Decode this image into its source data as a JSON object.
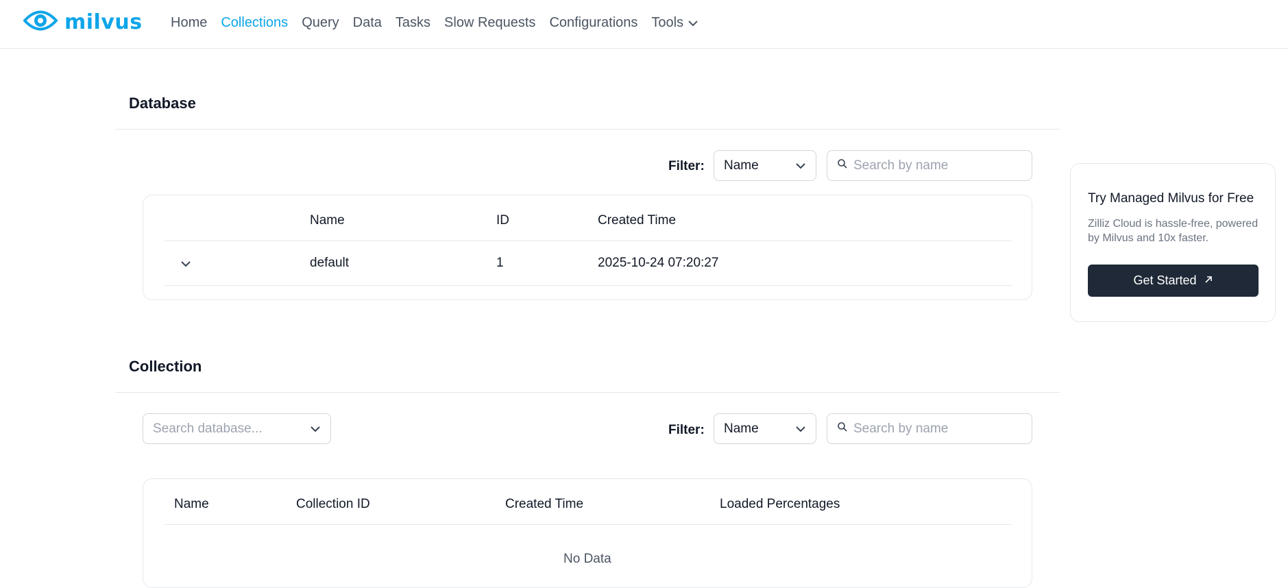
{
  "brand": {
    "name": "milvus",
    "accent": "#0ea5e9"
  },
  "nav": {
    "items": [
      {
        "label": "Home"
      },
      {
        "label": "Collections",
        "active": true
      },
      {
        "label": "Query"
      },
      {
        "label": "Data"
      },
      {
        "label": "Tasks"
      },
      {
        "label": "Slow Requests"
      },
      {
        "label": "Configurations"
      },
      {
        "label": "Tools",
        "icon": "chevron-down-icon"
      }
    ]
  },
  "database": {
    "title": "Database",
    "filter": {
      "label": "Filter:",
      "field": "Name",
      "search_placeholder": "Search by name",
      "search_value": ""
    },
    "table": {
      "columns": [
        "Name",
        "ID",
        "Created Time"
      ],
      "rows": [
        {
          "name": "default",
          "id": "1",
          "created_time": "2025-10-24 07:20:27",
          "icon": "chevron-down-icon"
        }
      ]
    }
  },
  "collection": {
    "title": "Collection",
    "database_select_placeholder": "Search database...",
    "filter": {
      "label": "Filter:",
      "field": "Name",
      "search_placeholder": "Search by name",
      "search_value": ""
    },
    "table": {
      "columns": [
        "Name",
        "Collection ID",
        "Created Time",
        "Loaded Percentages"
      ],
      "empty_text": "No Data"
    }
  },
  "promo": {
    "title": "Try Managed Milvus for Free",
    "description": "Zilliz Cloud is hassle-free, powered by Milvus and 10x faster.",
    "button_label": "Get Started",
    "button_icon": "arrow-up-right-icon"
  }
}
